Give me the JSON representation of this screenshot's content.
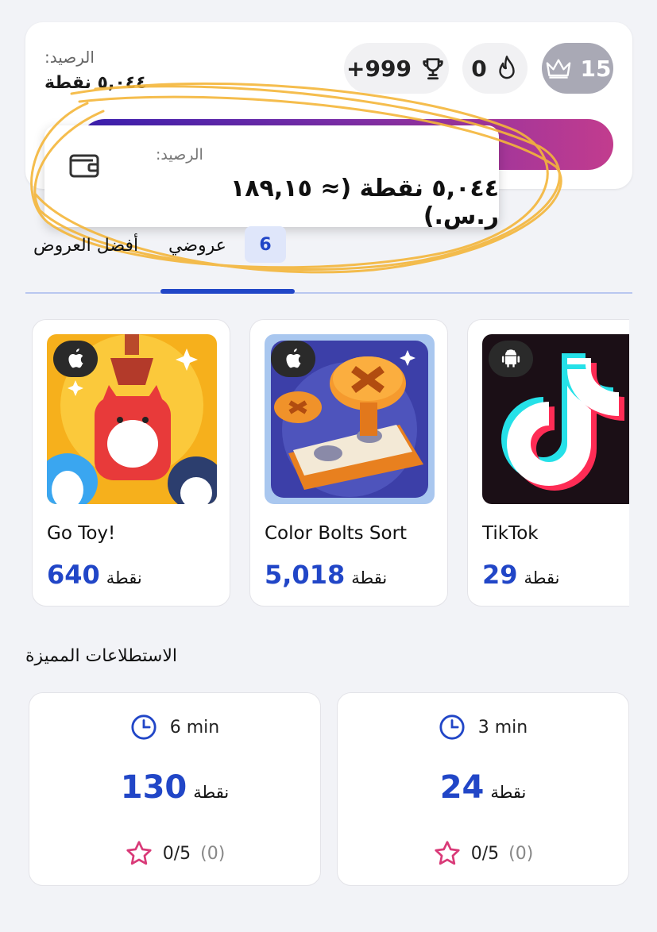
{
  "header": {
    "balance_label": "الرصيد:",
    "balance_value": "٥,٠٤٤ نقطة",
    "trophy_value": "+999",
    "trophy_icon": "trophy-icon",
    "streak_value": "0",
    "streak_icon": "flame-icon",
    "level_value": "15",
    "level_icon": "crown-icon"
  },
  "popup": {
    "label": "الرصيد:",
    "value": "٥,٠٤٤ نقطة (≈ ١٨٩,١٥ ر.س.)",
    "icon": "wallet-icon"
  },
  "tabs": {
    "best_offers": "أفضل العروض",
    "my_offers": "عروضي",
    "my_offers_count": "6"
  },
  "offers": [
    {
      "name": "Go Toy!",
      "points": "640",
      "unit": "نقطة",
      "platform": "apple-icon"
    },
    {
      "name": "Color Bolts Sort",
      "points": "5,018",
      "unit": "نقطة",
      "platform": "apple-icon"
    },
    {
      "name": "TikTok",
      "points": "29",
      "unit": "نقطة",
      "platform": "android-icon"
    }
  ],
  "surveys_title": "الاستطلاعات المميزة",
  "surveys": [
    {
      "time": "6 min",
      "points": "130",
      "unit": "نقطة",
      "rating": "0/5",
      "count": "(0)"
    },
    {
      "time": "3 min",
      "points": "24",
      "unit": "نقطة",
      "rating": "0/5",
      "count": "(0)"
    }
  ],
  "colors": {
    "accent": "#2146c7",
    "gradient_start": "#3a1fb0",
    "gradient_end": "#c23c8e",
    "star": "#d93a78",
    "annotation": "#f4b63a"
  }
}
